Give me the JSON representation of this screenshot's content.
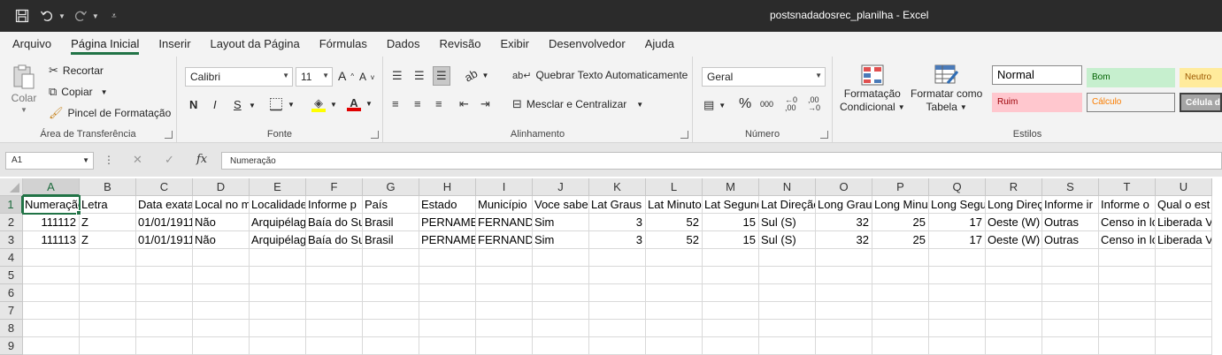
{
  "app": {
    "window_title": "postsnadadosrec_planilha  -  Excel"
  },
  "qat": {
    "save_icon": "save-icon",
    "undo_icon": "undo-icon",
    "redo_icon": "redo-icon",
    "customize_icon": "customize-qat-icon"
  },
  "tabs": [
    {
      "label": "Arquivo"
    },
    {
      "label": "Página Inicial",
      "active": true
    },
    {
      "label": "Inserir"
    },
    {
      "label": "Layout da Página"
    },
    {
      "label": "Fórmulas"
    },
    {
      "label": "Dados"
    },
    {
      "label": "Revisão"
    },
    {
      "label": "Exibir"
    },
    {
      "label": "Desenvolvedor"
    },
    {
      "label": "Ajuda"
    }
  ],
  "ribbon": {
    "clipboard": {
      "label": "Área de Transferência",
      "paste": "Colar",
      "cut": "Recortar",
      "copy": "Copiar",
      "format_painter": "Pincel de Formatação"
    },
    "font": {
      "label": "Fonte",
      "font_name": "Calibri",
      "font_size": "11",
      "bold": "N",
      "italic": "I",
      "underline": "S"
    },
    "alignment": {
      "label": "Alinhamento",
      "wrap_text": "Quebrar Texto Automaticamente",
      "merge_center": "Mesclar e Centralizar"
    },
    "number": {
      "label": "Número",
      "format": "Geral",
      "percent": "%",
      "thousands": "000"
    },
    "styles": {
      "label": "Estilos",
      "conditional_formatting": [
        "Formatação",
        "Condicional"
      ],
      "format_as_table": [
        "Formatar como",
        "Tabela"
      ],
      "cell_styles": [
        {
          "label": "Normal"
        },
        {
          "label": "Bom"
        },
        {
          "label": "Neutro"
        },
        {
          "label": "Ruim"
        },
        {
          "label": "Cálculo"
        },
        {
          "label": "Célula de"
        }
      ]
    }
  },
  "formula_bar": {
    "name_box": "A1",
    "fx": "fx",
    "content": "Numeração"
  },
  "sheet": {
    "columns": [
      "A",
      "B",
      "C",
      "D",
      "E",
      "F",
      "G",
      "H",
      "I",
      "J",
      "K",
      "L",
      "M",
      "N",
      "O",
      "P",
      "Q",
      "R",
      "S",
      "T",
      "U"
    ],
    "row_numbers": [
      "1",
      "2",
      "3",
      "4",
      "5",
      "6",
      "7",
      "8",
      "9"
    ],
    "rows": [
      [
        "Numeração",
        "Letra",
        "Data exata",
        "Local no mapa",
        "Localidade",
        "Informe p",
        "País",
        "Estado",
        "Município",
        "Voce sabe",
        "Lat Graus",
        "Lat Minuto",
        "Lat Segundo",
        "Lat Direção",
        "Long Graus",
        "Long Minu",
        "Long Segu",
        "Long Direção",
        "Informe ir",
        "Informe o",
        "Qual o est"
      ],
      [
        "111112",
        "Z",
        "01/01/1911",
        "Não",
        "Arquipélago",
        "Baía do Su",
        "Brasil",
        "PERNAMBUCO",
        "FERNANDO",
        "Sim",
        "3",
        "52",
        "15",
        "Sul (S)",
        "32",
        "25",
        "17",
        "Oeste (W)",
        "Outras",
        "Censo in lo",
        "Liberada V"
      ],
      [
        "111113",
        "Z",
        "01/01/1911",
        "Não",
        "Arquipélago",
        "Baía do Su",
        "Brasil",
        "PERNAMBUCO",
        "FERNANDO",
        "Sim",
        "3",
        "52",
        "15",
        "Sul (S)",
        "32",
        "25",
        "17",
        "Oeste (W)",
        "Outras",
        "Censo in lo",
        "Liberada V"
      ]
    ]
  }
}
